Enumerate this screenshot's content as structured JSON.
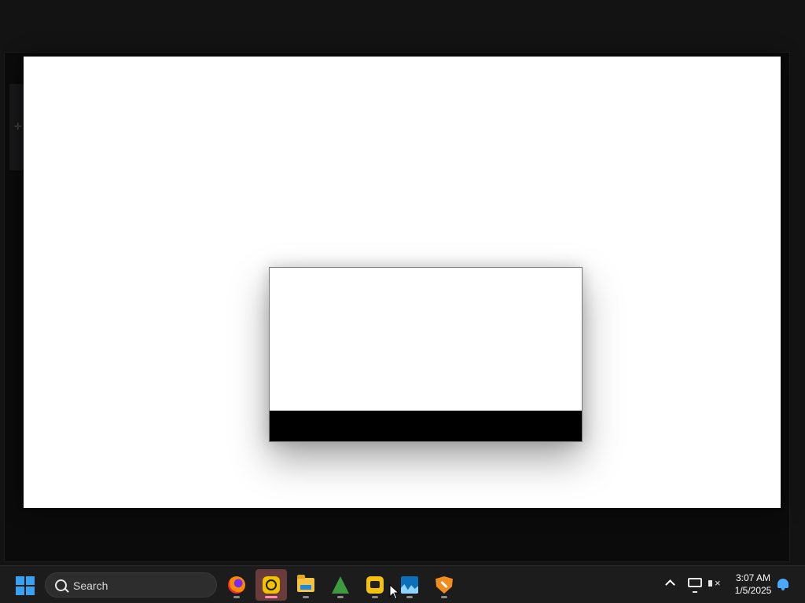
{
  "taskbar": {
    "search_placeholder": "Search",
    "apps": [
      {
        "name": "Firefox",
        "icon": "firefox-icon"
      },
      {
        "name": "Remote app",
        "icon": "remote-app-icon",
        "active": true
      },
      {
        "name": "File Explorer",
        "icon": "folder-icon"
      },
      {
        "name": "Tree app",
        "icon": "tree-icon"
      },
      {
        "name": "Yellow app",
        "icon": "yellow-app-icon"
      },
      {
        "name": "Wave app",
        "icon": "wave-icon"
      },
      {
        "name": "Shield tools",
        "icon": "shield-icon"
      }
    ],
    "clock": {
      "time": "3:07 AM",
      "date": "1/5/2025"
    }
  },
  "colors": {
    "taskbar_bg": "#1c1c1c",
    "desktop_bg": "#131314",
    "start_blue": "#3aa0f0"
  }
}
